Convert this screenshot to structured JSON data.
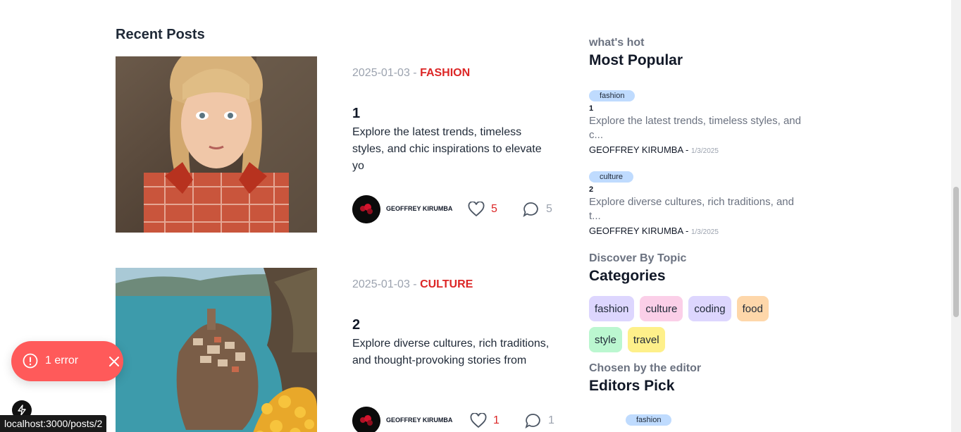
{
  "recent": {
    "title": "Recent Posts"
  },
  "posts": [
    {
      "date": "2025-01-03",
      "separator": " - ",
      "category": "fashion",
      "title": "1",
      "excerpt": "Explore the latest trends, timeless styles, and chic inspirations to elevate yo",
      "author": "GEOFFREY KIRUMBA",
      "likes": "5",
      "comments": "5"
    },
    {
      "date": "2025-01-03",
      "separator": " - ",
      "category": "culture",
      "title": "2",
      "excerpt": "Explore diverse cultures, rich traditions, and thought-provoking stories from",
      "author": "GEOFFREY KIRUMBA",
      "likes": "1",
      "comments": "1"
    }
  ],
  "sidebar": {
    "popular": {
      "subtitle": "what's hot",
      "title": "Most Popular",
      "items": [
        {
          "tag": "fashion",
          "num": "1",
          "desc": "Explore the latest trends, timeless styles, and c...",
          "author": "GEOFFREY KIRUMBA - ",
          "date": "1/3/2025"
        },
        {
          "tag": "culture",
          "num": "2",
          "desc": "Explore diverse cultures, rich traditions, and t...",
          "author": "GEOFFREY KIRUMBA - ",
          "date": "1/3/2025"
        }
      ]
    },
    "categories": {
      "subtitle": "Discover By Topic",
      "title": "Categories",
      "items": [
        {
          "label": "fashion",
          "color": "#ddd6fe"
        },
        {
          "label": "culture",
          "color": "#fbcfe8"
        },
        {
          "label": "coding",
          "color": "#ddd6fe"
        },
        {
          "label": "food",
          "color": "#fed7aa"
        },
        {
          "label": "style",
          "color": "#bbf7d0"
        },
        {
          "label": "travel",
          "color": "#fef08a"
        }
      ]
    },
    "editors": {
      "subtitle": "Chosen by the editor",
      "title": "Editors Pick",
      "first_tag": "fashion"
    }
  },
  "toast": {
    "text": "1 error"
  },
  "status_bar": {
    "url": "localhost:3000/posts/2"
  },
  "colors": {
    "accent": "#dc2626",
    "toast": "#ff5a5a",
    "tag_blue": "#bfdbfe"
  }
}
